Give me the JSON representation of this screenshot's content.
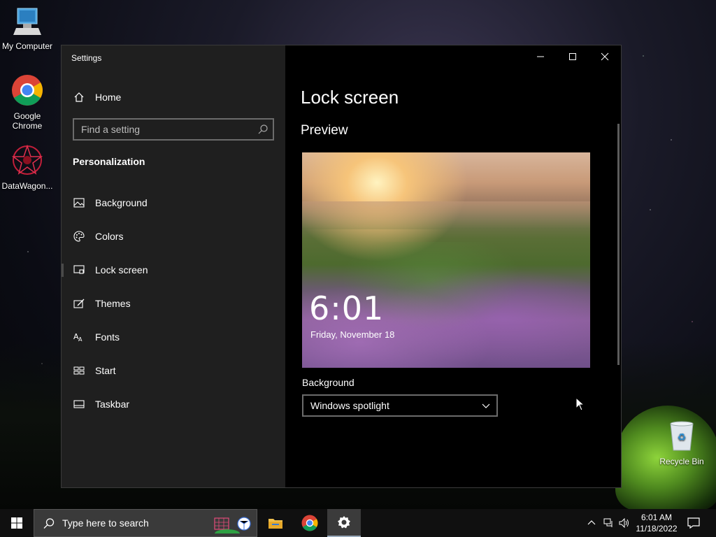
{
  "desktop": {
    "icons": [
      {
        "label": "My Computer"
      },
      {
        "label": "Google Chrome"
      },
      {
        "label": "DataWagon..."
      },
      {
        "label": "Recycle Bin"
      }
    ]
  },
  "window": {
    "title": "Settings",
    "controls": {
      "minimize": "—",
      "maximize": "☐",
      "close": "✕"
    }
  },
  "sidebar": {
    "home_label": "Home",
    "search_placeholder": "Find a setting",
    "section_label": "Personalization",
    "items": [
      {
        "label": "Background",
        "icon": "image-icon"
      },
      {
        "label": "Colors",
        "icon": "palette-icon"
      },
      {
        "label": "Lock screen",
        "icon": "lock-screen-icon",
        "active": true
      },
      {
        "label": "Themes",
        "icon": "themes-icon"
      },
      {
        "label": "Fonts",
        "icon": "fonts-icon"
      },
      {
        "label": "Start",
        "icon": "start-icon"
      },
      {
        "label": "Taskbar",
        "icon": "taskbar-icon"
      }
    ]
  },
  "content": {
    "title": "Lock screen",
    "preview_heading": "Preview",
    "preview": {
      "time": "6:01",
      "date": "Friday, November 18"
    },
    "background_label": "Background",
    "background_value": "Windows spotlight"
  },
  "taskbar": {
    "search_placeholder": "Type here to search",
    "clock_time": "6:01 AM",
    "clock_date": "11/18/2022"
  },
  "colors": {
    "sidebar_bg": "#1f1f1f",
    "content_bg": "#000000",
    "taskbar_bg": "#101010"
  }
}
